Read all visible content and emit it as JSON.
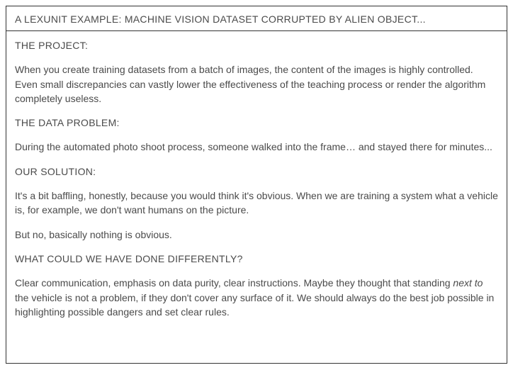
{
  "header": {
    "title": "A LEXUNIT EXAMPLE: MACHINE VISION DATASET CORRUPTED BY ALIEN OBJECT..."
  },
  "sections": {
    "project": {
      "label": "THE PROJECT:",
      "body": "When you create training datasets from a batch of images, the content of the images is highly controlled. Even small discrepancies can vastly lower the effectiveness of the teaching process or render the algorithm completely useless."
    },
    "data_problem": {
      "label": "THE DATA PROBLEM:",
      "body": "During the automated photo shoot process, someone walked into the frame… and stayed there for minutes..."
    },
    "solution": {
      "label": "OUR SOLUTION:",
      "body1": "It's a bit baffling, honestly, because you would think it's obvious. When we are training a system what a vehicle is, for example, we don't want humans on the picture.",
      "body2": "But no, basically nothing is obvious."
    },
    "differently": {
      "label": "WHAT COULD WE HAVE DONE DIFFERENTLY?",
      "body_pre": "Clear communication, emphasis on data purity, clear instructions. Maybe they thought that standing ",
      "body_em": "next to",
      "body_post": " the vehicle is not a problem, if they don't cover any surface of it. We should always do the best job possible in highlighting possible dangers and set clear rules."
    }
  }
}
